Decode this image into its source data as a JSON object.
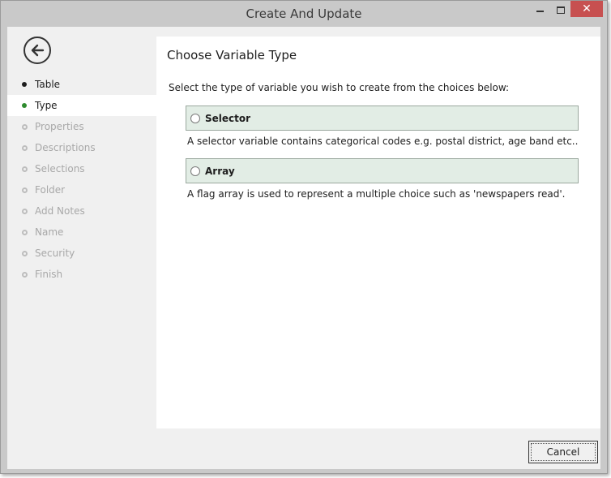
{
  "window": {
    "title": "Create And Update"
  },
  "sidebar": {
    "steps": [
      {
        "label": "Table",
        "state": "done"
      },
      {
        "label": "Type",
        "state": "current"
      },
      {
        "label": "Properties",
        "state": "pending"
      },
      {
        "label": "Descriptions",
        "state": "pending"
      },
      {
        "label": "Selections",
        "state": "pending"
      },
      {
        "label": "Folder",
        "state": "pending"
      },
      {
        "label": "Add Notes",
        "state": "pending"
      },
      {
        "label": "Name",
        "state": "pending"
      },
      {
        "label": "Security",
        "state": "pending"
      },
      {
        "label": "Finish",
        "state": "pending"
      }
    ]
  },
  "main": {
    "heading": "Choose Variable Type",
    "instruction": "Select the type of variable you wish to create from the choices below:",
    "choices": [
      {
        "label": "Selector",
        "description": "A selector variable contains categorical codes e.g. postal district, age band etc.."
      },
      {
        "label": "Array",
        "description": "A flag array is used to represent a multiple choice such as 'newspapers read'."
      }
    ]
  },
  "footer": {
    "cancel_label": "Cancel"
  },
  "colors": {
    "choice_background": "#e2ede5",
    "current_step_dot": "#2e8b2e",
    "close_button": "#c75050"
  }
}
